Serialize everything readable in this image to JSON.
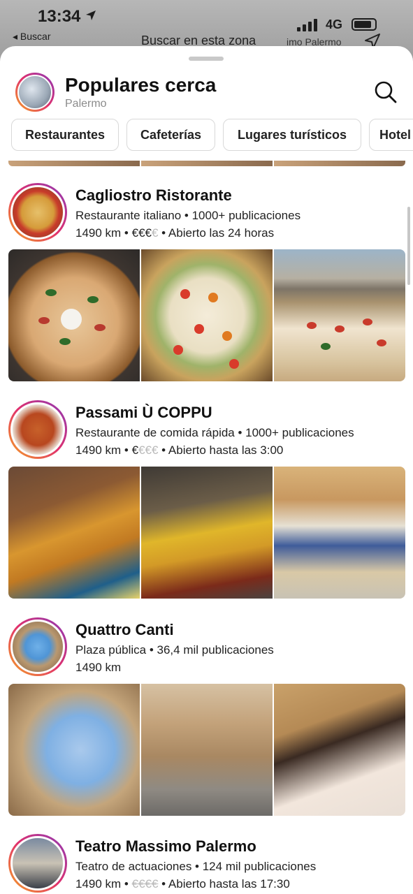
{
  "status_bar": {
    "time": "13:34",
    "back_label": "◂ Buscar",
    "network": "4G"
  },
  "map": {
    "search_area_label": "Buscar en esta zona",
    "corner_label": "imo Palermo"
  },
  "header": {
    "title": "Populares cerca",
    "subtitle": "Palermo"
  },
  "categories": [
    "Restaurantes",
    "Cafeterías",
    "Lugares turísticos",
    "Hotel"
  ],
  "places": [
    {
      "name": "Cagliostro Ristorante",
      "line1": "Restaurante italiano • 1000+ publicaciones",
      "distance": "1490 km",
      "price_active": "€€€",
      "price_inactive": "€",
      "hours": "Abierto las 24 horas"
    },
    {
      "name": "Passami Ù COPPU",
      "line1": "Restaurante de comida rápida • 1000+ publicaciones",
      "distance": "1490 km",
      "price_active": "€",
      "price_inactive": "€€€",
      "hours": "Abierto hasta las 3:00"
    },
    {
      "name": "Quattro Canti",
      "line1": "Plaza pública • 36,4 mil publicaciones",
      "distance": "1490 km"
    },
    {
      "name": "Teatro Massimo Palermo",
      "line1": "Teatro de actuaciones • 124 mil publicaciones",
      "distance": "1490 km",
      "price_active": "€€€€",
      "hours": "Abierto hasta las 17:30"
    }
  ],
  "sep": " • "
}
